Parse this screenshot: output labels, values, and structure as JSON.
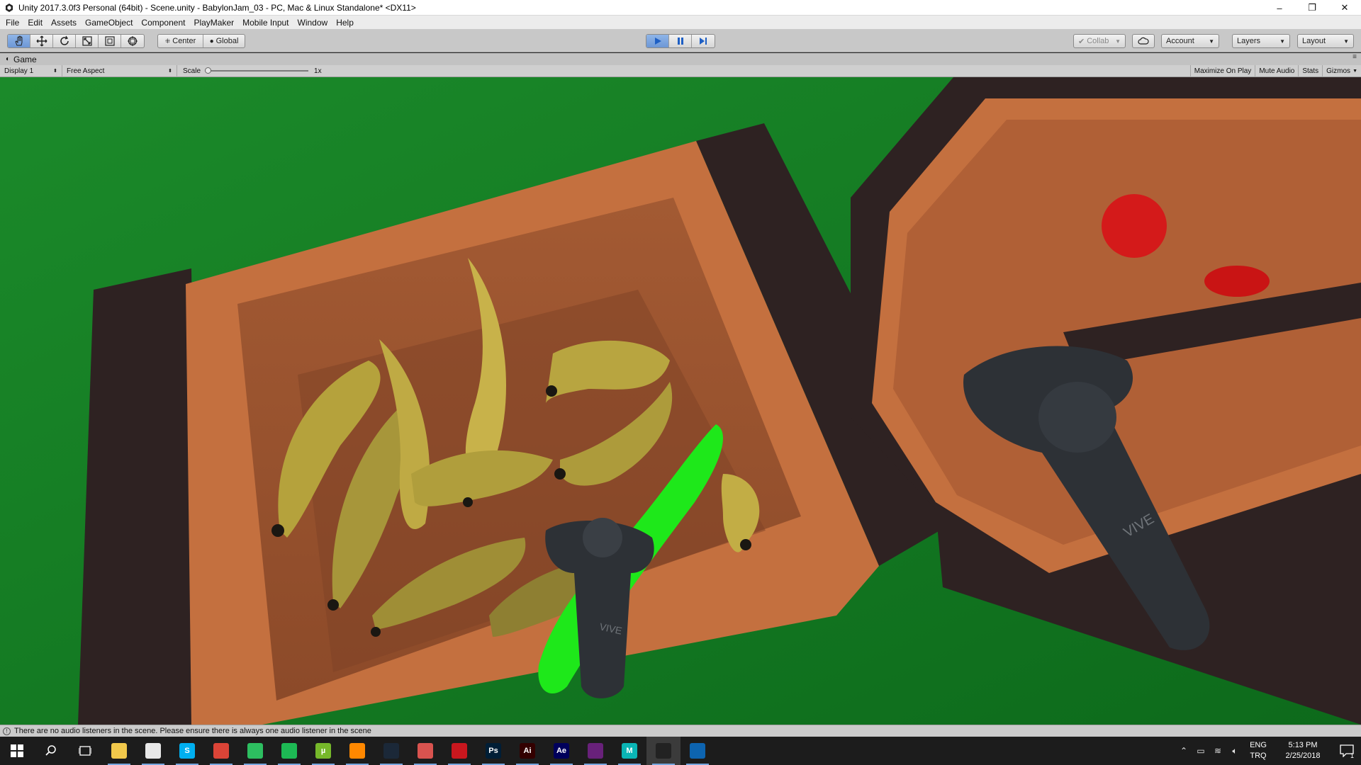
{
  "window": {
    "title": "Unity 2017.3.0f3 Personal (64bit) - Scene.unity - BabylonJam_03 - PC, Mac & Linux Standalone* <DX11>",
    "controls": {
      "minimize": "–",
      "restore": "❐",
      "close": "✕"
    }
  },
  "menu": {
    "items": [
      "File",
      "Edit",
      "Assets",
      "GameObject",
      "Component",
      "PlayMaker",
      "Mobile Input",
      "Window",
      "Help"
    ]
  },
  "toolbar": {
    "tools": [
      "hand-icon",
      "move-icon",
      "rotate-icon",
      "scale-icon",
      "rect-tool-icon",
      "transform-icon"
    ],
    "pivot_label": "Center",
    "rotation_label": "Global",
    "play_state": "playing",
    "collab_label": "Collab",
    "account_label": "Account",
    "layers_label": "Layers",
    "layout_label": "Layout",
    "accent_color": "#6d97d6"
  },
  "game_tab": {
    "label": "Game",
    "display": "Display 1",
    "aspect": "Free Aspect",
    "scale_label": "Scale",
    "scale_value": "1x",
    "scale_level": 0,
    "toggles": [
      "Maximize On Play",
      "Mute Audio",
      "Stats",
      "Gizmos"
    ]
  },
  "scene": {
    "controller_brand_left": "VIVE",
    "controller_brand_right": "VIVE",
    "colors": {
      "ground": "#137c22",
      "crate": "#c4703f",
      "crate_dark": "#2e2222",
      "banana": "#b5a23c",
      "banana_highlight": "#1ee81a",
      "apple": "#d41a1a",
      "controller": "#2d3136"
    }
  },
  "status": {
    "message": "There are no audio listeners in the scene. Please ensure there is always one audio listener in the scene"
  },
  "taskbar": {
    "apps": [
      {
        "name": "file-explorer",
        "label": "",
        "color": "#f1c84b"
      },
      {
        "name": "paint",
        "label": "",
        "color": "#e8e8e8"
      },
      {
        "name": "skype",
        "label": "S",
        "color": "#00aff0"
      },
      {
        "name": "chrome",
        "label": "",
        "color": "#db4437"
      },
      {
        "name": "evernote",
        "label": "",
        "color": "#2dbe60"
      },
      {
        "name": "spotify",
        "label": "",
        "color": "#1db954"
      },
      {
        "name": "utorrent",
        "label": "µ",
        "color": "#76b82a"
      },
      {
        "name": "vlc",
        "label": "",
        "color": "#ff8800"
      },
      {
        "name": "steam",
        "label": "",
        "color": "#1b2838"
      },
      {
        "name": "sketchup",
        "label": "",
        "color": "#d9534f"
      },
      {
        "name": "acrobat",
        "label": "",
        "color": "#c9171e"
      },
      {
        "name": "photoshop",
        "label": "Ps",
        "color": "#001e36"
      },
      {
        "name": "illustrator",
        "label": "Ai",
        "color": "#330000"
      },
      {
        "name": "after-effects",
        "label": "Ae",
        "color": "#00005b"
      },
      {
        "name": "visual-studio",
        "label": "",
        "color": "#68217a"
      },
      {
        "name": "maya",
        "label": "M",
        "color": "#0ab4b4"
      },
      {
        "name": "unity",
        "label": "",
        "color": "#222222"
      },
      {
        "name": "steamvr",
        "label": "",
        "color": "#0d64b0"
      }
    ],
    "lang_top": "ENG",
    "lang_bottom": "TRQ",
    "time": "5:13 PM",
    "date": "2/25/2018",
    "notification_count": "1"
  }
}
